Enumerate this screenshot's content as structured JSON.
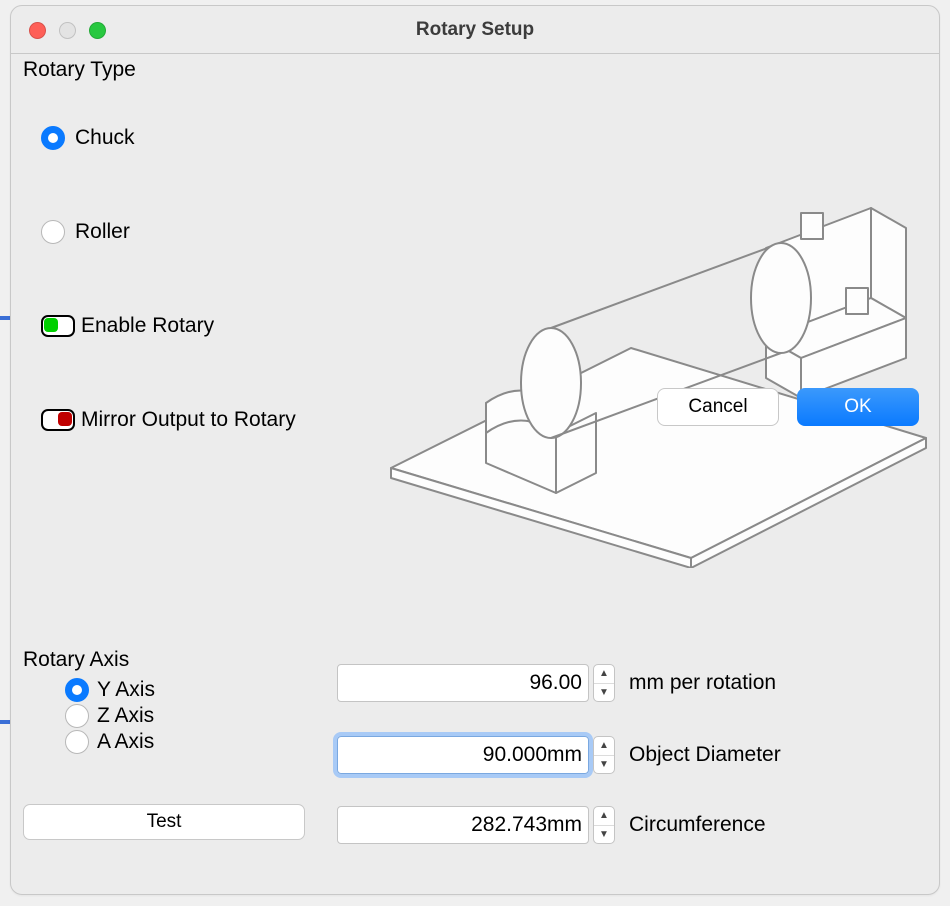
{
  "window": {
    "title": "Rotary Setup"
  },
  "rotary_type": {
    "section_label": "Rotary Type",
    "chuck": "Chuck",
    "roller": "Roller",
    "selected": "chuck"
  },
  "toggles": {
    "enable_rotary": "Enable Rotary",
    "mirror_output": "Mirror Output to Rotary"
  },
  "rotary_axis": {
    "section_label": "Rotary Axis",
    "y": "Y Axis",
    "z": "Z Axis",
    "a": "A Axis",
    "selected": "y"
  },
  "params": {
    "mm_per_rotation": {
      "value": "96.00",
      "label": "mm per rotation"
    },
    "object_diameter": {
      "value": "90.000mm",
      "label": "Object Diameter"
    },
    "circumference": {
      "value": "282.743mm",
      "label": "Circumference"
    }
  },
  "buttons": {
    "test": "Test",
    "cancel": "Cancel",
    "ok": "OK"
  }
}
